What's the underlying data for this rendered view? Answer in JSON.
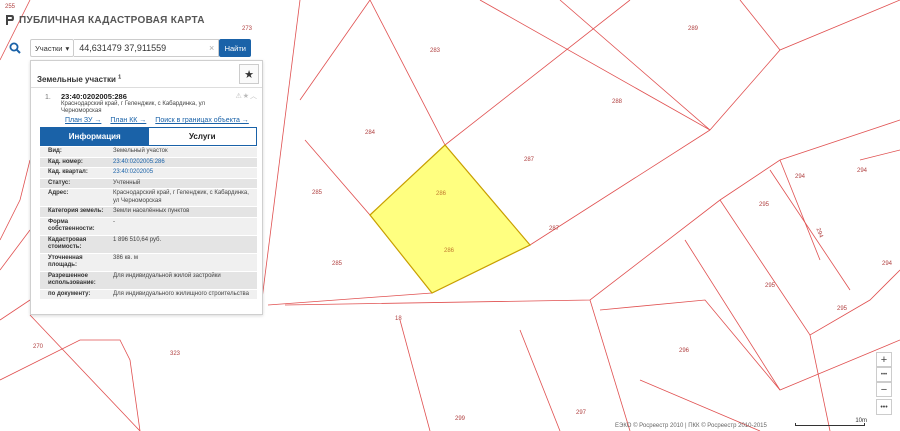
{
  "app": {
    "title": "ПУБЛИЧНАЯ КАДАСТРОВАЯ КАРТА"
  },
  "search": {
    "type_label": "Участки",
    "query": "44,631479 37,911559",
    "button_label": "Найти"
  },
  "panel": {
    "title": "Земельные участки",
    "count": "1",
    "result": {
      "index": "1.",
      "cad_number": "23:40:0202005:286",
      "address": "Краснодарский край, г Геленджик, с Кабардинка, ул Черноморская",
      "links": [
        "План ЗУ →",
        "План КК →",
        "Поиск в границах объекта →"
      ]
    },
    "tabs": [
      "Информация",
      "Услуги"
    ],
    "attributes": [
      {
        "key": "Вид:",
        "value": "Земельный участок"
      },
      {
        "key": "Кад. номер:",
        "value": "23:40:0202005:286"
      },
      {
        "key": "Кад. квартал:",
        "value": "23:40:0202005"
      },
      {
        "key": "Статус:",
        "value": "Учтенный"
      },
      {
        "key": "Адрес:",
        "value": "Краснодарский край, г Геленджик, с Кабардинка, ул Черноморская"
      },
      {
        "key": "Категория земель:",
        "value": "Земли населённых пунктов"
      },
      {
        "key": "Форма собственности:",
        "value": "-"
      },
      {
        "key": "Кадастровая стоимость:",
        "value": "1 896 510,64 руб."
      },
      {
        "key": "Уточненная площадь:",
        "value": "386 кв. м"
      },
      {
        "key": "Разрешенное использование:",
        "value": "Для индивидуальной жилой застройки"
      },
      {
        "key": "по документу:",
        "value": "Для индивидуального жилищного строительства"
      }
    ]
  },
  "map": {
    "parcel_labels": [
      "255",
      "273",
      "283",
      "289",
      "288",
      "284",
      "287",
      "286",
      "286",
      "285",
      "287",
      "285",
      "294",
      "294",
      "295",
      "294",
      "295",
      "294",
      "295",
      "18",
      "270",
      "323",
      "296",
      "299",
      "297"
    ],
    "colors": {
      "boundary": "#e05050",
      "selected_fill": "#ffff80",
      "selected_border": "#c8a000",
      "accent": "#1a62a8"
    }
  },
  "controls": {
    "zoom_in": "+",
    "zoom_out": "−",
    "dots": "•••"
  },
  "footer": {
    "attribution": "ЕЭКО © Росреестр 2010 | ПКК © Росреестр 2010-2015",
    "scale": "10m"
  },
  "icons": {
    "logo": "logo-icon",
    "search": "search-icon",
    "clear": "clear-icon",
    "star": "star-icon",
    "chevron": "chevron-down-icon"
  }
}
